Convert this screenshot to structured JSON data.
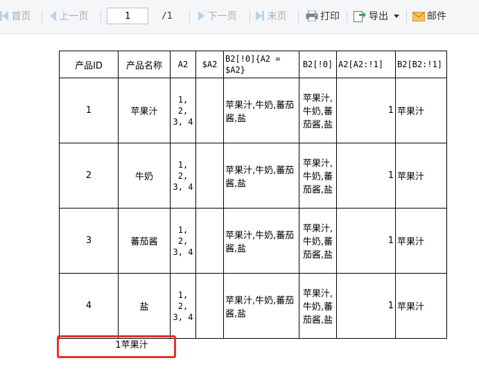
{
  "toolbar": {
    "first_label": "首页",
    "prev_label": "上一页",
    "page_value": "1",
    "page_total": "/1",
    "next_label": "下一页",
    "last_label": "末页",
    "print_label": "打印",
    "export_label": "导出",
    "mail_label": "邮件"
  },
  "table": {
    "headers": [
      "产品ID",
      "产品名称",
      "A2",
      "$A2",
      "B2[!0]{A2 = $A2}",
      "B2[!0]",
      "A2[A2:!1]",
      "B2[B2:!1]"
    ],
    "rows": [
      [
        "1",
        "苹果汁",
        "1, 2, 3, 4",
        "",
        "苹果汁,牛奶,蕃茄酱,盐",
        "苹果汁,牛奶,蕃茄酱,盐",
        "1",
        "苹果汁"
      ],
      [
        "2",
        "牛奶",
        "1, 2, 3, 4",
        "",
        "苹果汁,牛奶,蕃茄酱,盐",
        "苹果汁,牛奶,蕃茄酱,盐",
        "1",
        "苹果汁"
      ],
      [
        "3",
        "蕃茄酱",
        "1, 2, 3, 4",
        "",
        "苹果汁,牛奶,蕃茄酱,盐",
        "苹果汁,牛奶,蕃茄酱,盐",
        "1",
        "苹果汁"
      ],
      [
        "4",
        "盐",
        "1, 2, 3, 4",
        "",
        "苹果汁,牛奶,蕃茄酱,盐",
        "苹果汁,牛奶,蕃茄酱,盐",
        "1",
        "苹果汁"
      ]
    ]
  },
  "footer": {
    "text": "1苹果汁"
  },
  "colors": {
    "highlight": "#e8302b",
    "toolbar_bg": "#f4f6f8"
  }
}
